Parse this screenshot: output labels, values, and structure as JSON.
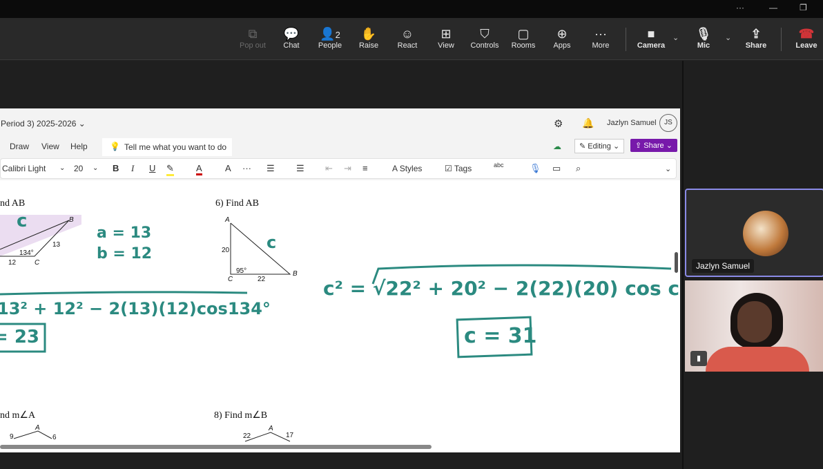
{
  "window": {
    "more": "···",
    "minimize": "—",
    "restore": "❐"
  },
  "toolbar": {
    "items": [
      {
        "label": "Pop out",
        "icon": "⧉",
        "disabled": true
      },
      {
        "label": "Chat",
        "icon": "💬"
      },
      {
        "label": "People",
        "icon": "👤",
        "count": "2"
      },
      {
        "label": "Raise",
        "icon": "✋"
      },
      {
        "label": "React",
        "icon": "☺"
      },
      {
        "label": "View",
        "icon": "⊞"
      },
      {
        "label": "Controls",
        "icon": "⛉"
      },
      {
        "label": "Rooms",
        "icon": "▢"
      },
      {
        "label": "Apps",
        "icon": "⊕"
      },
      {
        "label": "More",
        "icon": "···"
      }
    ],
    "camera": "Camera",
    "mic": "Mic",
    "share": "Share",
    "leave": "Leave",
    "chevron": "⌄"
  },
  "onenote": {
    "notebook": "Period 3) 2025-2026 ⌄",
    "user": "Jazlyn Samuel",
    "initials": "JS",
    "menu": [
      "Draw",
      "View",
      "Help"
    ],
    "tell_me": "Tell me what you want to do",
    "editing": "Editing ⌄",
    "share": "Share ⌄",
    "font": "Calibri Light",
    "size": "20",
    "styles": "Styles",
    "tags": "Tags",
    "spell": "abc"
  },
  "page": {
    "p5": "nd AB",
    "p6": "6)  Find AB",
    "p7": "nd m∠A",
    "p8": "8)  Find m∠B",
    "fig5": {
      "side1": "13",
      "side2": "12",
      "angle": "134°",
      "C": "C",
      "B": "B"
    },
    "fig6": {
      "A": "A",
      "B": "B",
      "C": "C",
      "side1": "20",
      "side2": "22",
      "angle": "95°"
    },
    "fig7": {
      "a": "9",
      "b": "6",
      "A": "A"
    },
    "fig8": {
      "a": "22",
      "b": "17",
      "A": "A"
    },
    "ink": {
      "c1": "c",
      "a13": "a = 13",
      "b12": "b = 12",
      "eq1": "13² + 12² − 2(13)(12)cos134°",
      "ans1": "= 23",
      "c2": "c",
      "eq2": "c² = √22² + 20² − 2(22)(20) cos c",
      "ans2": "c = 31"
    }
  },
  "participants": [
    {
      "name": "Jazlyn Samuel"
    },
    {
      "name": ""
    }
  ],
  "colors": {
    "ink": "#2b8a80",
    "share": "#7719aa",
    "leave": "#d13438"
  }
}
